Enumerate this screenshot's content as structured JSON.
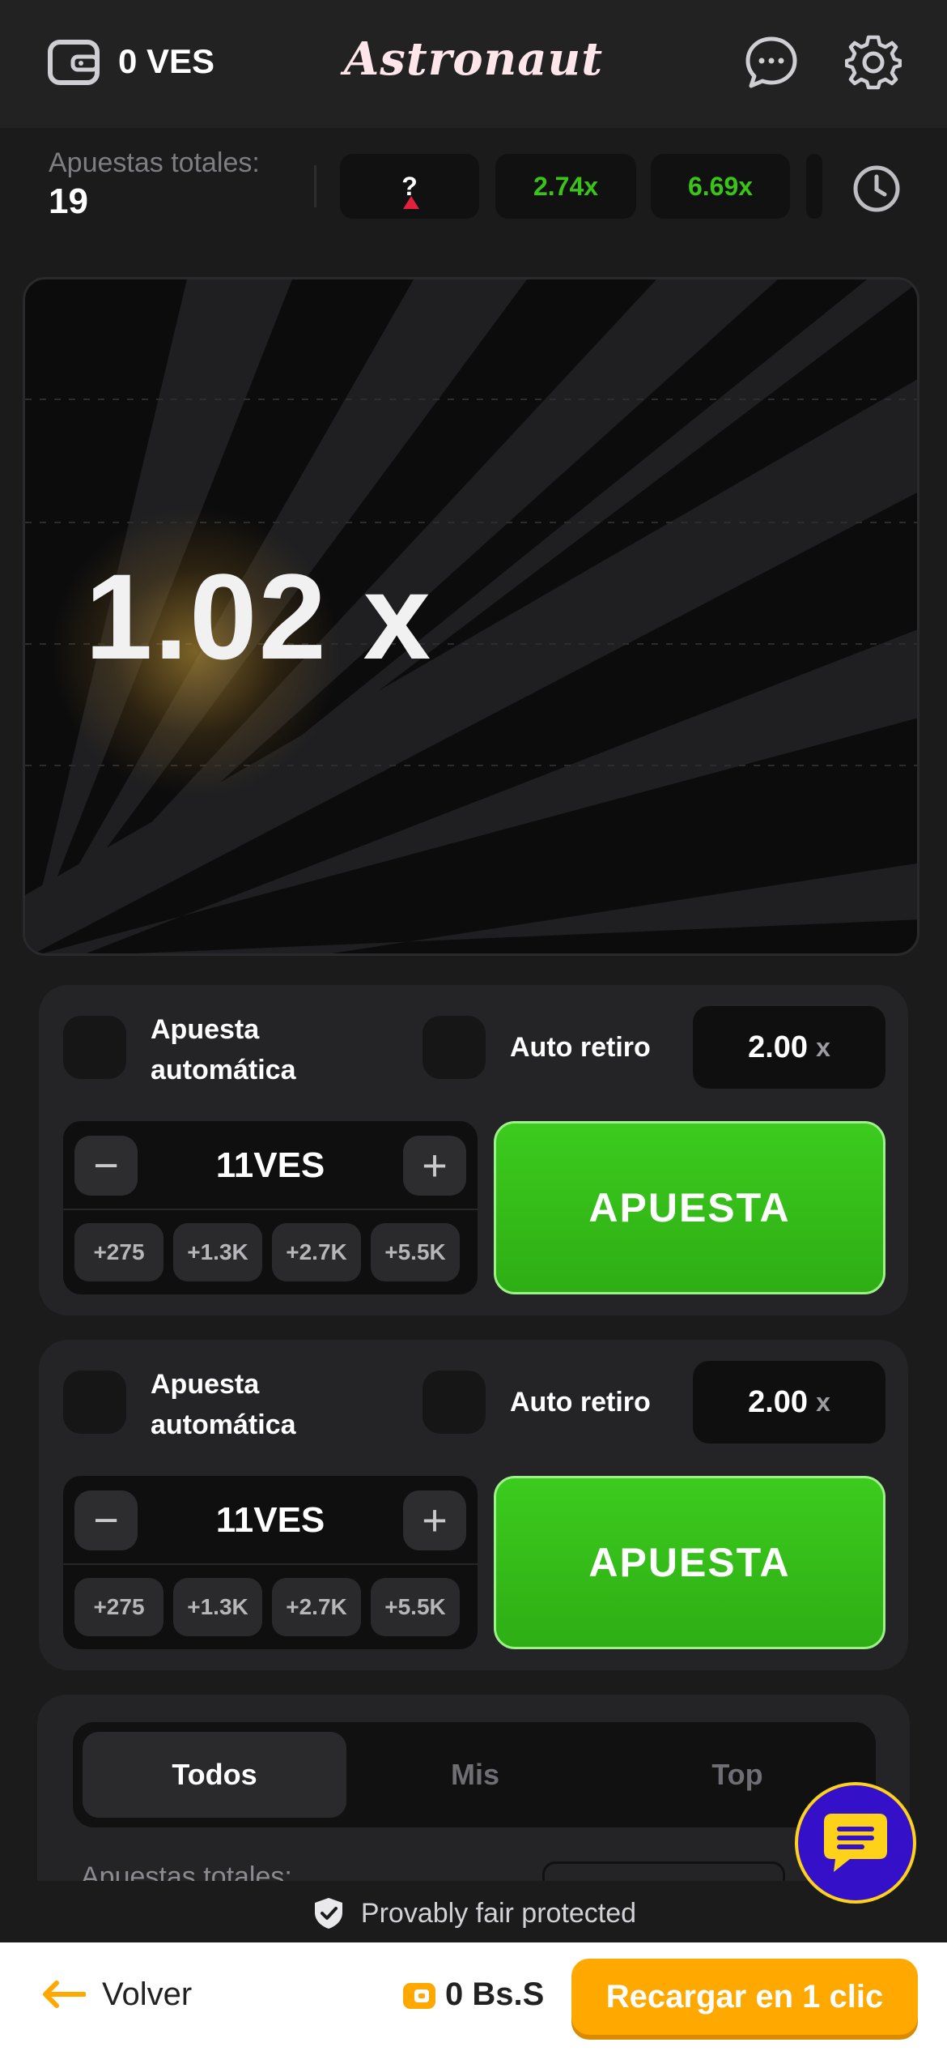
{
  "header": {
    "balance": "0 VES",
    "logo": "Astronaut"
  },
  "history": {
    "total_label": "Apuestas totales:",
    "total_value": "19",
    "chips": [
      "?",
      "2.74x",
      "6.69x"
    ]
  },
  "game": {
    "multiplier": "1.02 x"
  },
  "bet_panels": [
    {
      "auto_bet_label": "Apuesta automática",
      "auto_cashout_label": "Auto retiro",
      "auto_cashout_value": "2.00",
      "auto_cashout_suffix": "x",
      "minus": "−",
      "plus": "+",
      "amount": "11VES",
      "quick": [
        "+275",
        "+1.3K",
        "+2.7K",
        "+5.5K"
      ],
      "bet_button": "APUESTA"
    },
    {
      "auto_bet_label": "Apuesta automática",
      "auto_cashout_label": "Auto retiro",
      "auto_cashout_value": "2.00",
      "auto_cashout_suffix": "x",
      "minus": "−",
      "plus": "+",
      "amount": "11VES",
      "quick": [
        "+275",
        "+1.3K",
        "+2.7K",
        "+5.5K"
      ],
      "bet_button": "APUESTA"
    }
  ],
  "bets": {
    "tabs": [
      "Todos",
      "Mis",
      "Top"
    ],
    "total_label": "Apuestas totales:"
  },
  "footer": {
    "fair_text": "Provably fair protected",
    "back": "Volver",
    "bs_balance": "0 Bs.S",
    "recharge": "Recargar en 1 clic"
  },
  "colors": {
    "accent_green": "#3ccb1e",
    "win_green": "#3ac41a",
    "loss_red": "#e0223c",
    "recharge_orange": "#ffa800",
    "support_blue": "#3411c9",
    "support_yellow": "#ffd21a"
  },
  "icons": [
    "wallet-icon",
    "chat-icon",
    "gear-icon",
    "clock-icon",
    "shield-icon",
    "support-chat-icon",
    "back-arrow-icon",
    "coin-icon"
  ]
}
